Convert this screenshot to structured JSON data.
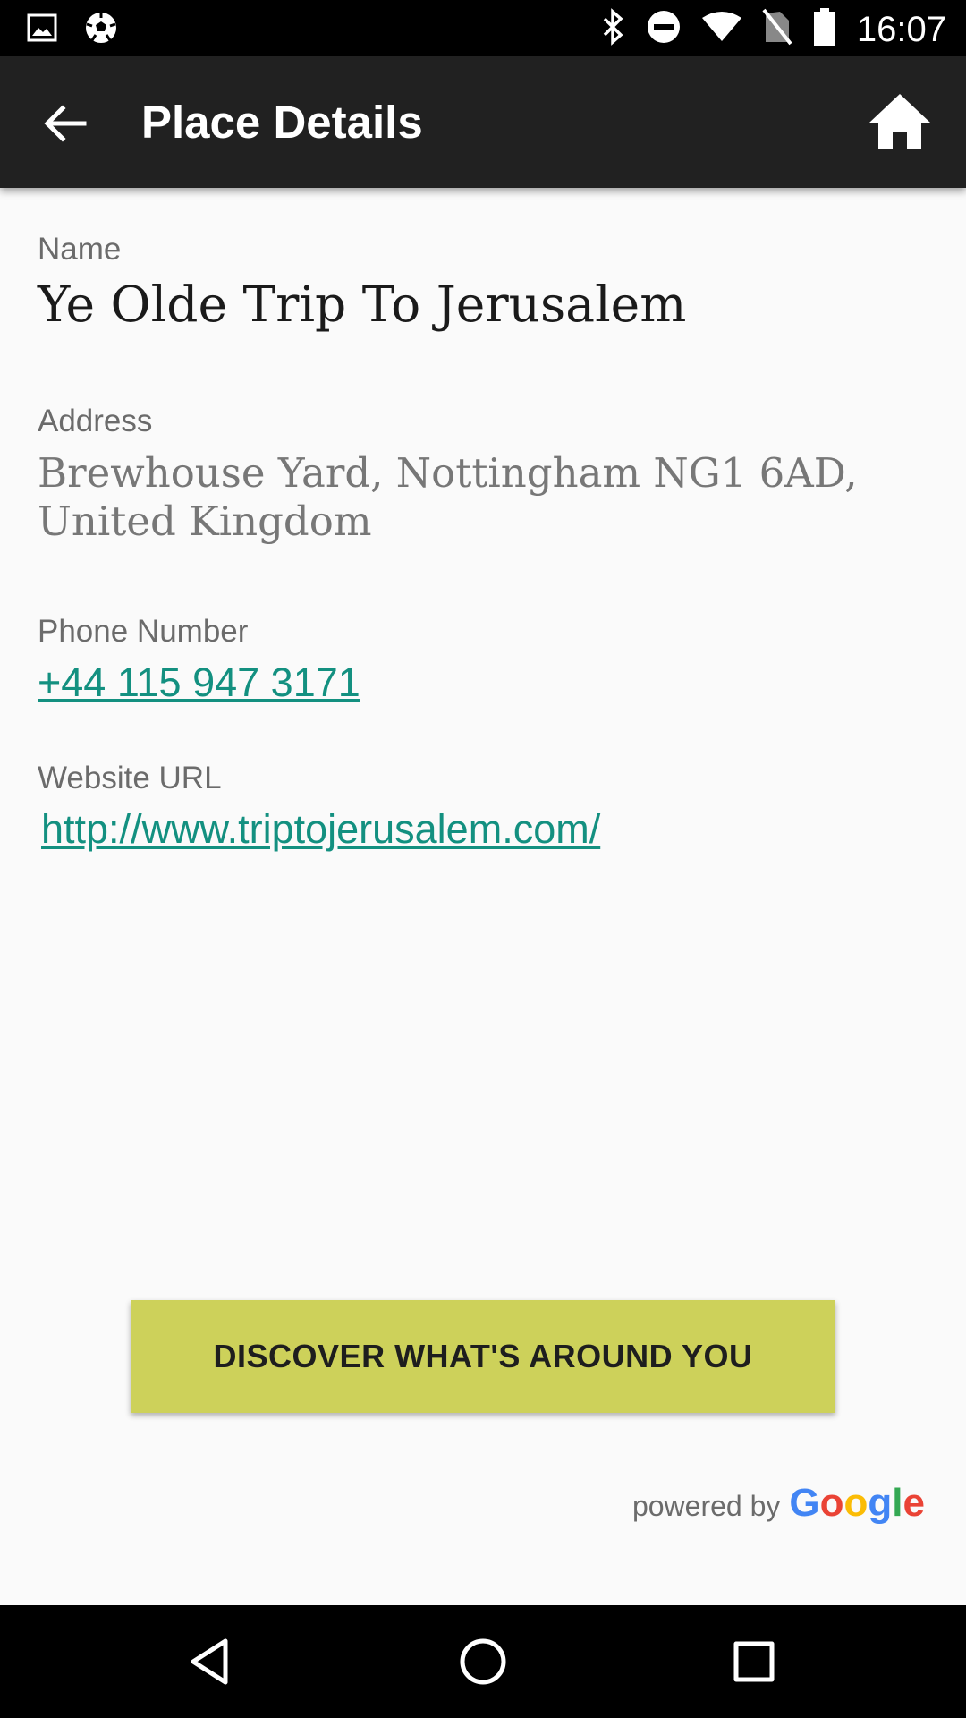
{
  "status_bar": {
    "time": "16:07",
    "left_icons": [
      "image-icon",
      "soccer-ball-icon"
    ],
    "right_icons": [
      "bluetooth-icon",
      "do-not-disturb-icon",
      "wifi-icon",
      "no-sim-icon",
      "battery-icon"
    ]
  },
  "app_bar": {
    "title": "Place Details",
    "back_icon": "arrow-back-icon",
    "home_icon": "home-icon"
  },
  "details": {
    "name_label": "Name",
    "name_value": "Ye Olde Trip To Jerusalem",
    "address_label": "Address",
    "address_line1": "Brewhouse Yard, Nottingham NG1 6AD,",
    "address_line2": "United Kingdom",
    "phone_label": "Phone Number",
    "phone_value": "+44 115 947 3171",
    "website_label": "Website URL",
    "website_value": "http://www.triptojerusalem.com/"
  },
  "discover_button": {
    "label": "DISCOVER WHAT'S AROUND YOU"
  },
  "attribution": {
    "prefix": "powered by",
    "brand_letters": [
      "G",
      "o",
      "o",
      "g",
      "l",
      "e"
    ],
    "brand_colors": [
      "#4285F4",
      "#EA4335",
      "#FBBC05",
      "#4285F4",
      "#34A853",
      "#EA4335"
    ]
  },
  "colors": {
    "app_bar": "#212121",
    "background": "#fafafa",
    "link": "#139080",
    "button": "#cdd15a"
  },
  "nav_bar": {
    "buttons": [
      "back-triangle-icon",
      "home-circle-icon",
      "recents-square-icon"
    ]
  }
}
